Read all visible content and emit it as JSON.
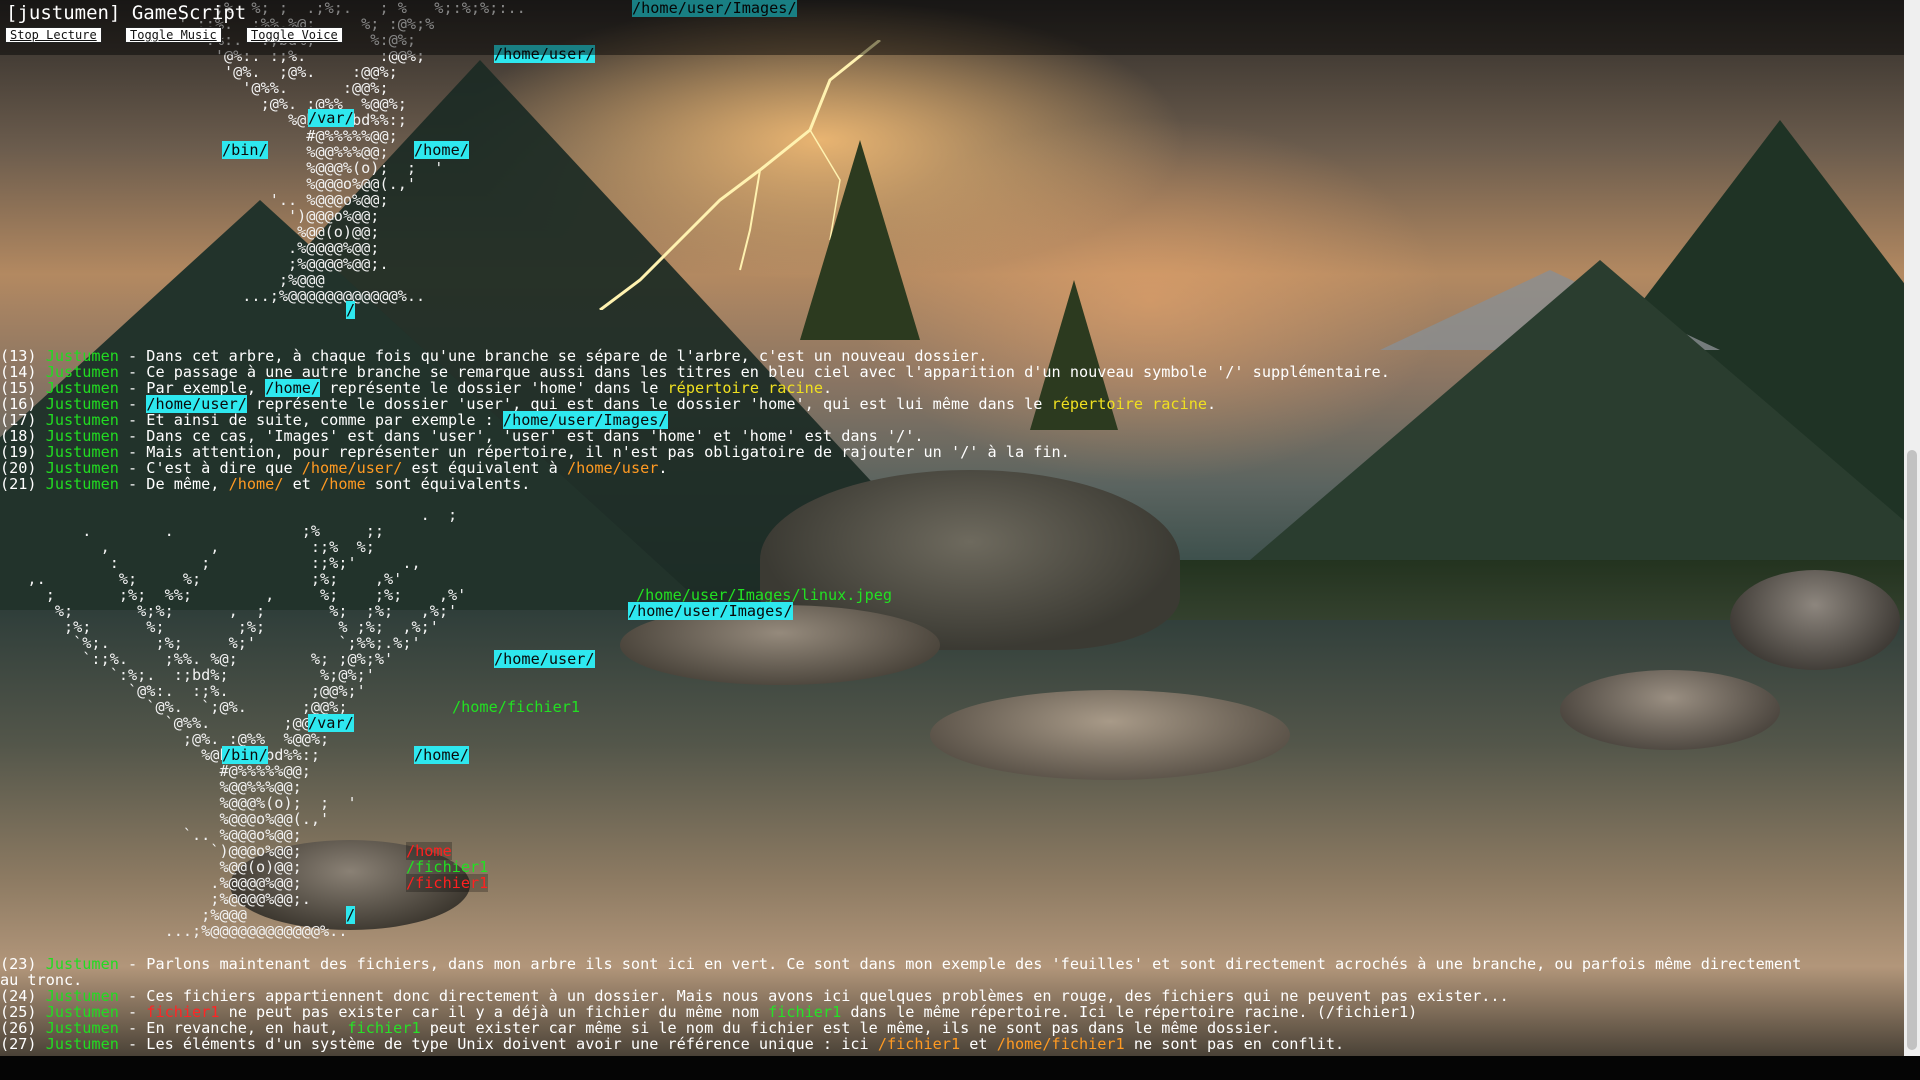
{
  "window": {
    "title": "[justumen] GameScript"
  },
  "toolbar": {
    "stop_label": "Stop Lecture",
    "music_label": "Toggle Music",
    "voice_label": "Toggle Voice"
  },
  "tree1": {
    "top_label": "/home/user/Images/",
    "labels": {
      "user": "/home/user/",
      "var": "/var/",
      "bin": "/bin/",
      "home": "/home/",
      "root": "/"
    },
    "art": [
      ". .   ;%  %; ;  .;%;.   ; %   %;:%;%;:..",
      "  ' :;%.  ;%%.%@;     %; :@%;% ",
      "    ':%:.  :;bd%;      %:@%;",
      "      '@%:. :;%.        :@@%;",
      "       '@%.  ;@%.    :@@%;",
      "         '@%%.      :@@%;",
      "           ;@%. :@%%  %@@%;",
      "              %@bd%%%bd%%:;",
      "                #@%%%%%@@;",
      "                %@@%%%@@;",
      "                %@@@%(o);  ;  '",
      "                %@@@o%@@(.,'",
      "            '.. %@@@o%@@;",
      "              ')@@@o%@@;",
      "               %@@(o)@@;",
      "              .%@@@@%@@;",
      "              ;%@@@@%@@;.",
      "             ;%@@@",
      "         ...;%@@@@@@@@@@@@%.."
    ]
  },
  "dialog1": [
    {
      "num": "(13)",
      "speaker": "Justumen",
      "parts": [
        {
          "t": " - Dans cet arbre, à chaque fois qu'une branche se sépare de l'arbre, c'est un nouveau dossier."
        }
      ]
    },
    {
      "num": "(14)",
      "speaker": "Justumen",
      "parts": [
        {
          "t": " - Ce passage à une autre branche se remarque aussi dans les titres en bleu ciel avec l'apparition d'un nouveau symbole '/' supplémentaire."
        }
      ]
    },
    {
      "num": "(15)",
      "speaker": "Justumen",
      "parts": [
        {
          "t": " - Par exemple, "
        },
        {
          "t": "/home/",
          "c": "path"
        },
        {
          "t": " représente le dossier 'home' dans le "
        },
        {
          "t": "répertoire racine",
          "c": "yel"
        },
        {
          "t": "."
        }
      ]
    },
    {
      "num": "(16)",
      "speaker": "Justumen",
      "parts": [
        {
          "t": " - "
        },
        {
          "t": "/home/user/",
          "c": "path"
        },
        {
          "t": " représente le dossier 'user', qui est dans le dossier 'home', qui est lui même dans le "
        },
        {
          "t": "répertoire racine",
          "c": "yel"
        },
        {
          "t": "."
        }
      ]
    },
    {
      "num": "(17)",
      "speaker": "Justumen",
      "parts": [
        {
          "t": " - Et ainsi de suite, comme par exemple : "
        },
        {
          "t": "/home/user/Images/",
          "c": "path"
        }
      ]
    },
    {
      "num": "(18)",
      "speaker": "Justumen",
      "parts": [
        {
          "t": " - Dans ce cas, 'Images' est dans 'user', 'user' est dans 'home' et 'home' est dans '/'."
        }
      ]
    },
    {
      "num": "(19)",
      "speaker": "Justumen",
      "parts": [
        {
          "t": " - Mais attention, pour représenter un répertoire, il n'est pas obligatoire de rajouter un '/' à la fin."
        }
      ]
    },
    {
      "num": "(20)",
      "speaker": "Justumen",
      "parts": [
        {
          "t": " - C'est à dire que "
        },
        {
          "t": "/home/user/",
          "c": "org"
        },
        {
          "t": " est équivalent à "
        },
        {
          "t": "/home/user",
          "c": "org"
        },
        {
          "t": "."
        }
      ]
    },
    {
      "num": "(21)",
      "speaker": "Justumen",
      "parts": [
        {
          "t": " - De même, "
        },
        {
          "t": "/home/",
          "c": "org"
        },
        {
          "t": " et "
        },
        {
          "t": "/home",
          "c": "org"
        },
        {
          "t": " sont équivalents."
        }
      ]
    }
  ],
  "tree2": {
    "file_label": "/home/user/Images/linux.jpeg",
    "top_label": "/home/user/Images/",
    "user_label": "/home/user/",
    "fichier_label": "/home/fichier1",
    "var_label": "/var/",
    "bin_label": "/bin/",
    "home_label": "/home/",
    "root_label": "/",
    "red_home": "/home",
    "green_fichier": "/fichier1",
    "red_fichier": "/fichier1",
    "art": [
      "                                              .  ;",
      "         .        .              ;%     ;;",
      "           ,           ,          :;%  %;",
      "            :         ;           :;%;'     .,",
      "   ,.        %;     %;            ;%;    ,%'",
      "     ;       ;%;  %%;        ,     %;    ;%;    ,%'",
      "      %;       %;%;      ,  ;       %;  ;%;   ,%;'",
      "       ;%;      %;        ;%;        % ;%;  ,%;'",
      "        `%;.     ;%;     %;'         `;%%;.%;'",
      "         `:;%.    ;%%. %@;        %; ;@%;%'",
      "            `:%;.  :;bd%;          %;@%;'",
      "              `@%:.  :;%.         ;@@%;'",
      "                `@%.  `;@%.      ;@@%;",
      "                  `@%%.        ;@@%;",
      "                    ;@%. :@%%  %@@%;",
      "                      %@bd%%%bd%%:;",
      "                        #@%%%%%@@;",
      "                        %@@%%%@@;",
      "                        %@@@%(o);  ;  '",
      "                        %@@@o%@@(.,'",
      "                    `.. %@@@o%@@;",
      "                       `)@@@o%@@;",
      "                        %@@(o)@@;",
      "                       .%@@@@%@@;",
      "                       ;%@@@@%@@;.",
      "                      ;%@@@",
      "                  ...;%@@@@@@@@@@@@%.."
    ]
  },
  "dialog2": [
    {
      "num": "(23)",
      "speaker": "Justumen",
      "parts": [
        {
          "t": " - Parlons maintenant des fichiers, dans mon arbre ils sont ici en vert. Ce sont dans mon exemple des 'feuilles' et sont directement acrochés à une branche, ou parfois même directement"
        }
      ]
    },
    {
      "num": "",
      "speaker": "",
      "parts": [
        {
          "t": "au tronc."
        }
      ]
    },
    {
      "num": "(24)",
      "speaker": "Justumen",
      "parts": [
        {
          "t": " - Ces fichiers appartiennent donc directement à un dossier. Mais nous avons ici quelques problèmes en rouge, des fichiers qui ne peuvent pas exister..."
        }
      ]
    },
    {
      "num": "(25)",
      "speaker": "Justumen",
      "parts": [
        {
          "t": " - "
        },
        {
          "t": "fichier1",
          "c": "red"
        },
        {
          "t": " ne peut pas exister car il y a déjà un fichier du même nom "
        },
        {
          "t": "fichier1",
          "c": "grn"
        },
        {
          "t": " dans le même répertoire. Ici le répertoire racine. (/fichier1)"
        }
      ]
    },
    {
      "num": "(26)",
      "speaker": "Justumen",
      "parts": [
        {
          "t": " - En revanche, en haut, "
        },
        {
          "t": "fichier1",
          "c": "grn"
        },
        {
          "t": " peut exister car même si le nom du fichier est le même, ils ne sont pas dans le même dossier."
        }
      ]
    },
    {
      "num": "(27)",
      "speaker": "Justumen",
      "parts": [
        {
          "t": " - Les éléments d'un système de type Unix doivent avoir une référence unique : ici "
        },
        {
          "t": "/fichier1",
          "c": "org"
        },
        {
          "t": " et "
        },
        {
          "t": "/home/fichier1",
          "c": "org"
        },
        {
          "t": " ne sont pas en conflit."
        }
      ]
    }
  ],
  "colors": {
    "path_bg": "#2ee8ef",
    "speaker": "#21dc21",
    "highlight_yellow": "#f0e020",
    "highlight_orange": "#ff9a22",
    "file_green": "#27e027",
    "file_red": "#ff2525"
  }
}
